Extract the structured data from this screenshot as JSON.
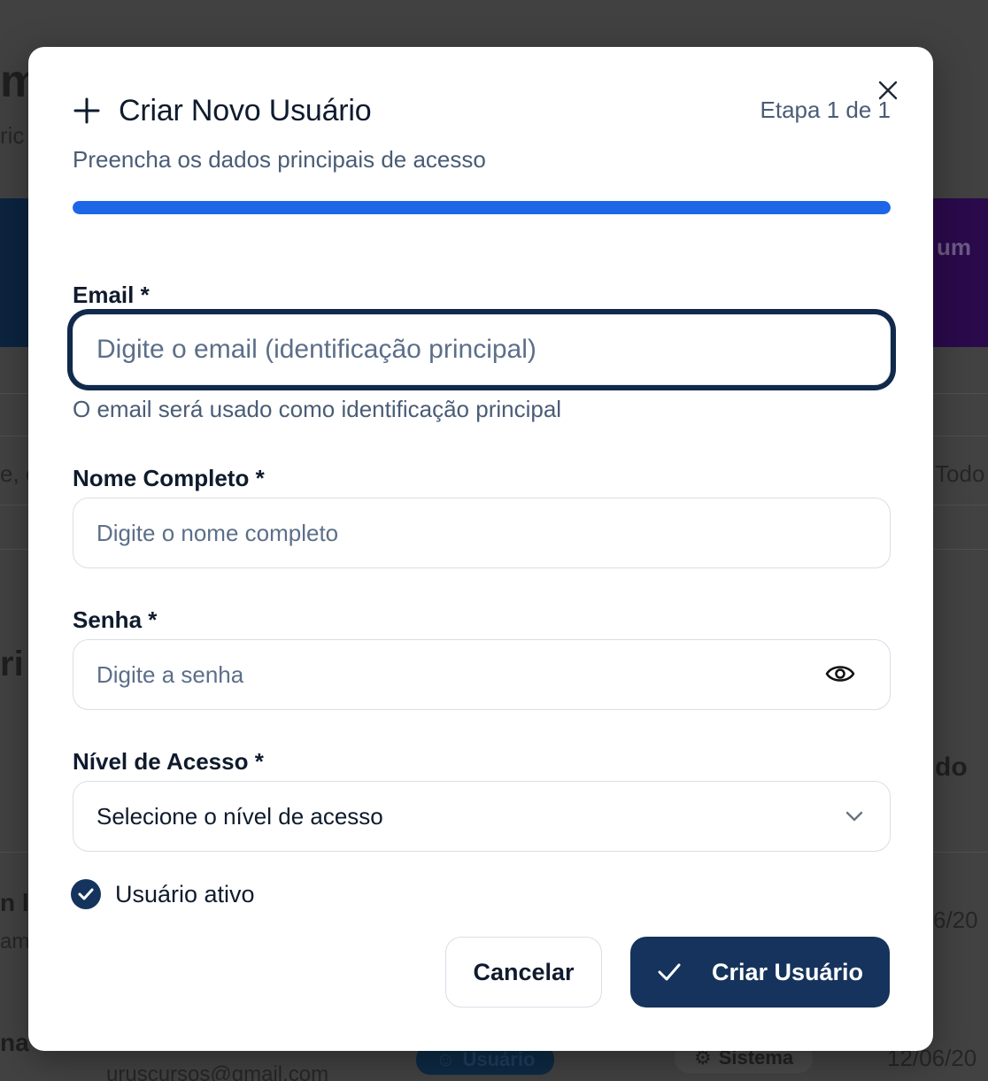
{
  "background": {
    "banner_text_right": "um",
    "filter_text": "Todo",
    "left_fragment_1": "m",
    "left_fragment_2": "ric",
    "left_fragment_3": "e, e",
    "left_fragment_4": "ri",
    "left_fragment_5": "n l",
    "left_fragment_6": "am",
    "left_fragment_7": "na",
    "right_fragment_1": "do",
    "right_fragment_2": "6/20",
    "email_fragment": "uruscursos@gmail.com",
    "badge_user": "Usuário",
    "badge_system": "Sistema",
    "date_fragment": "12/06/20"
  },
  "modal": {
    "title": "Criar Novo Usuário",
    "step_text": "Etapa 1 de 1",
    "subtitle": "Preencha os dados principais de acesso",
    "progress_fraction": 1.0,
    "fields": {
      "email": {
        "label": "Email *",
        "placeholder": "Digite o email (identificação principal)",
        "help": "O email será usado como identificação principal"
      },
      "name": {
        "label": "Nome Completo *",
        "placeholder": "Digite o nome completo"
      },
      "password": {
        "label": "Senha *",
        "placeholder": "Digite a senha"
      },
      "access": {
        "label": "Nível de Acesso *",
        "selected": "Selecione o nível de acesso"
      }
    },
    "active_checkbox": {
      "label": "Usuário ativo",
      "checked": true
    },
    "buttons": {
      "cancel": "Cancelar",
      "create": "Criar Usuário"
    }
  },
  "colors": {
    "primary": "#15335c",
    "progress": "#1e66e8",
    "muted_text": "#4a5c76"
  }
}
